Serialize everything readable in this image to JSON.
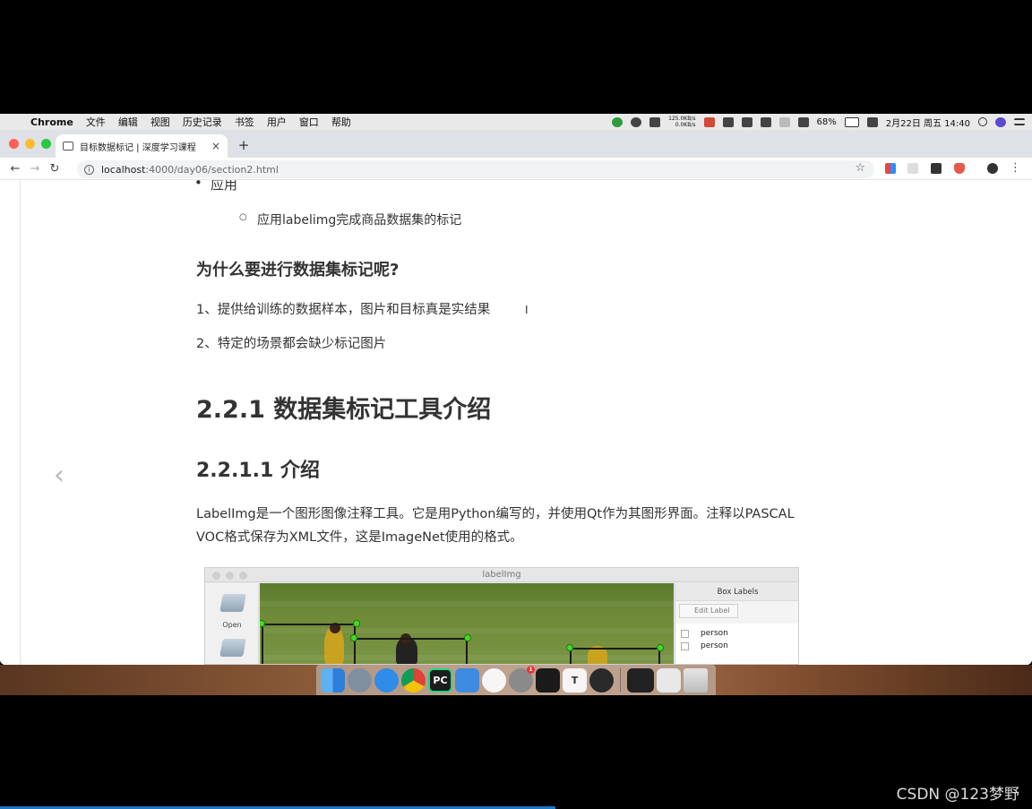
{
  "menubar": {
    "app": "Chrome",
    "items": [
      "文件",
      "编辑",
      "视图",
      "历史记录",
      "书签",
      "用户",
      "窗口",
      "帮助"
    ],
    "net_up": "125.0KB/s",
    "net_down": "0.0KB/s",
    "battery": "68%",
    "datetime": "2月22日 周五  14:40"
  },
  "browser": {
    "tab_title": "目标数据标记 | 深度学习课程",
    "tab_close": "×",
    "new_tab": "+",
    "url_host": "localhost",
    "url_path": ":4000/day06/section2.html"
  },
  "page": {
    "bullet_level1": "应用",
    "bullet_level2": "应用labelimg完成商品数据集的标记",
    "heading_why": "为什么要进行数据集标记呢?",
    "reason1": "1、提供给训练的数据样本，图片和目标真是实结果",
    "reason2": "2、特定的场景都会缺少标记图片",
    "h2": "2.2.1 数据集标记工具介绍",
    "h3": "2.2.1.1 介绍",
    "desc_line1": "LabelImg是一个图形图像注释工具。它是用Python编写的，并使用Qt作为其图形界面。注释以PASCAL",
    "desc_line2": "VOC格式保存为XML文件，这是ImageNet使用的格式。",
    "prev_arrow": "‹"
  },
  "labelimg": {
    "window_title": "labelImg",
    "open_label": "Open",
    "panel_title": "Box Labels",
    "edit_label": "Edit Label",
    "labels": [
      "person",
      "person"
    ]
  },
  "dock": {
    "apps": [
      "finder",
      "launchpad",
      "safari",
      "chrome",
      "pycharm",
      "keynote",
      "pixelmator",
      "system-preferences",
      "terminal",
      "typora",
      "obs",
      "screen",
      "preview",
      "trash"
    ],
    "badge": "1"
  },
  "watermark": "CSDN @123梦野"
}
